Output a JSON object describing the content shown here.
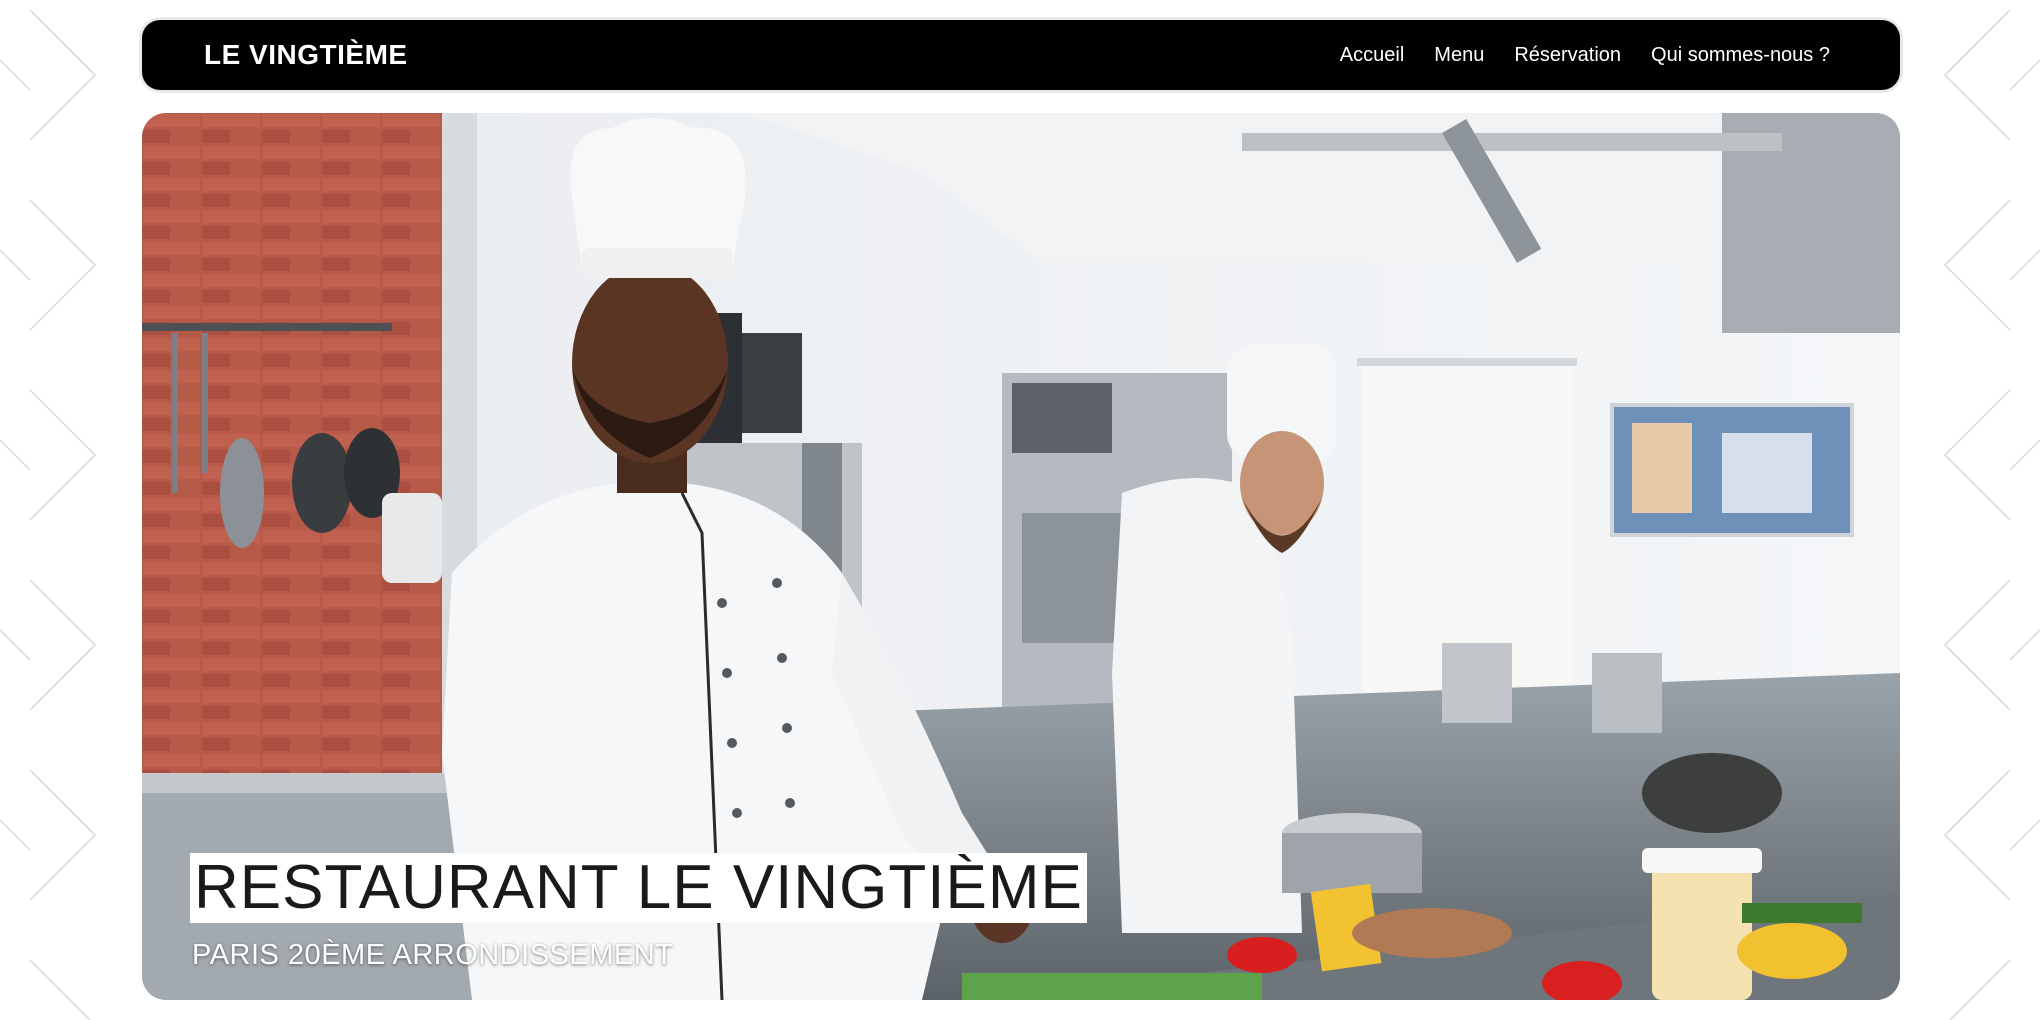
{
  "header": {
    "brand": "LE VINGTIÈME",
    "nav": [
      {
        "label": "Accueil"
      },
      {
        "label": "Menu"
      },
      {
        "label": "Réservation"
      },
      {
        "label": "Qui sommes-nous ?"
      }
    ]
  },
  "hero": {
    "title": "RESTAURANT LE VINGTIÈME",
    "subtitle": "PARIS 20ÈME ARRONDISSEMENT",
    "image": "chefs-in-kitchen-photo"
  },
  "colors": {
    "navbar_bg": "#000000",
    "nav_text": "#ffffff",
    "title_bg": "#ffffff",
    "title_text": "#1a1a1a"
  }
}
